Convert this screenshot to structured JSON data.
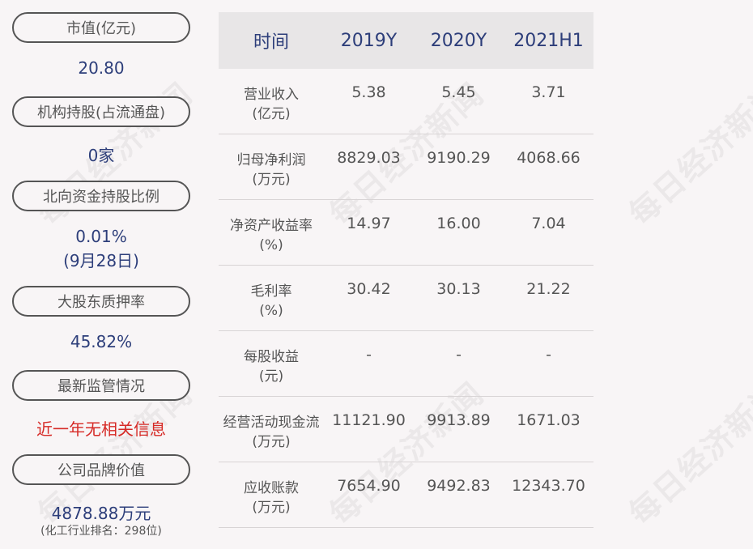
{
  "watermark": "每日经济新闻",
  "left": {
    "items": [
      {
        "label": "市值(亿元)",
        "value": "20.80"
      },
      {
        "label": "机构持股(占流通盘)",
        "value": "0家"
      },
      {
        "label": "北向资金持股比例",
        "value": "0.01%",
        "value2": "(9月28日)"
      },
      {
        "label": "大股东质押率",
        "value": "45.82%"
      },
      {
        "label": "最新监管情况",
        "value": "近一年无相关信息"
      },
      {
        "label": "公司品牌价值",
        "value": "4878.88万元",
        "note": "(化工行业排名：298位)"
      }
    ]
  },
  "table": {
    "headers": [
      "时间",
      "2019Y",
      "2020Y",
      "2021H1"
    ],
    "rows": [
      {
        "label1": "营业收入",
        "label2": "(亿元)",
        "values": [
          "5.38",
          "5.45",
          "3.71"
        ]
      },
      {
        "label1": "归母净利润",
        "label2": "(万元)",
        "values": [
          "8829.03",
          "9190.29",
          "4068.66"
        ]
      },
      {
        "label1": "净资产收益率",
        "label2": "(%)",
        "values": [
          "14.97",
          "16.00",
          "7.04"
        ]
      },
      {
        "label1": "毛利率",
        "label2": "(%)",
        "values": [
          "30.42",
          "30.13",
          "21.22"
        ]
      },
      {
        "label1": "每股收益",
        "label2": "(元)",
        "values": [
          "-",
          "-",
          "-"
        ]
      },
      {
        "label1": "经营活动现金流",
        "label2": "(万元)",
        "values": [
          "11121.90",
          "9913.89",
          "1671.03"
        ]
      },
      {
        "label1": "应收账款",
        "label2": "(万元)",
        "values": [
          "7654.90",
          "9492.83",
          "12343.70"
        ]
      }
    ]
  }
}
